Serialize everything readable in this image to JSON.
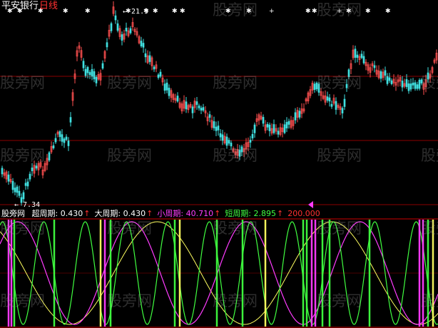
{
  "header": {
    "stock_name": "平安银行",
    "period": "日线"
  },
  "price": {
    "high_label": "← 21.9",
    "low_label": "← 7.34"
  },
  "indicator": {
    "name": "股旁网",
    "items": [
      {
        "label": "超周期:",
        "value": "0.430",
        "arrow": "↑",
        "color": "#ffffff"
      },
      {
        "label": "大周期:",
        "value": "0.430",
        "arrow": "↑",
        "color": "#ffffff"
      },
      {
        "label": "小周期:",
        "value": "40.710",
        "arrow": "↑",
        "color": "#ff3cff"
      },
      {
        "label": "短周期:",
        "value": "2.895",
        "arrow": "↑",
        "color": "#40ff40"
      },
      {
        "label": "",
        "value": "200.000",
        "arrow": "",
        "color": "#ff3030"
      }
    ]
  },
  "watermark": "股旁网",
  "colors": {
    "background": "#000000",
    "candle_up": "#ff5050",
    "candle_down": "#40e0e0",
    "grid": "#8b0000",
    "super_cycle": "#ffff60",
    "small_cycle": "#ff3cff",
    "short_cycle": "#40ff40"
  }
}
